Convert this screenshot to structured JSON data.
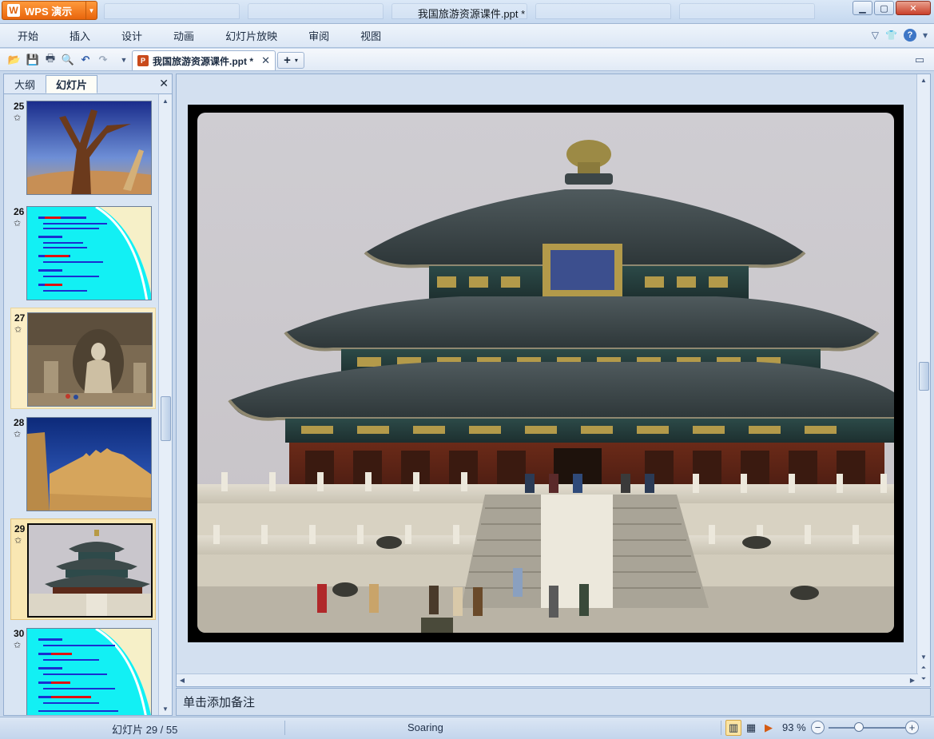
{
  "window": {
    "app_name": "WPS 演示",
    "app_logo": "W",
    "title": "我国旅游资源课件.ppt *"
  },
  "menu": {
    "items": [
      "开始",
      "插入",
      "设计",
      "动画",
      "幻灯片放映",
      "审阅",
      "视图"
    ]
  },
  "toolbar": {
    "doc_tab_label": "我国旅游资源课件.ppt *",
    "new_tab_label": "+"
  },
  "left_panel": {
    "tabs": [
      "大纲",
      "幻灯片"
    ],
    "active_tab": "幻灯片",
    "thumbnails": [
      {
        "number": "25",
        "content": "desert-tree-photo"
      },
      {
        "number": "26",
        "content": "cyan-text-slide"
      },
      {
        "number": "27",
        "content": "longmen-grottoes-photo"
      },
      {
        "number": "28",
        "content": "great-wall-photo"
      },
      {
        "number": "29",
        "content": "temple-of-heaven-photo",
        "selected": true
      },
      {
        "number": "30",
        "content": "cyan-text-slide"
      }
    ]
  },
  "slide": {
    "content": "temple-of-heaven-photo"
  },
  "notes": {
    "placeholder": "单击添加备注"
  },
  "status": {
    "slide_indicator": "幻灯片 29 / 55",
    "theme_name": "Soaring",
    "zoom": "93 %",
    "zoom_level": 0.93
  },
  "colors": {
    "app_button": "#e8650c",
    "selected_thumb": "#f9e7b3",
    "slide_frame": "#000000"
  }
}
